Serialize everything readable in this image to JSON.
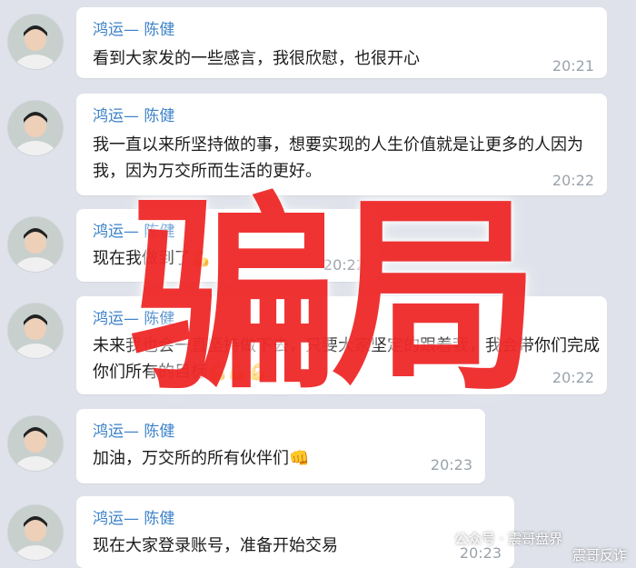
{
  "messages": [
    {
      "sender": "鸿运— 陈健",
      "text": "看到大家发的一些感言，我很欣慰，也很开心",
      "time": "20:21"
    },
    {
      "sender": "鸿运— 陈健",
      "text": "我一直以来所坚持做的事，想要实现的人生价值就是让更多的人因为我，因为万交所而生活的更好。",
      "time": "20:22"
    },
    {
      "sender": "鸿运— 陈健",
      "text": "现在我做到了💪",
      "time": "20:22"
    },
    {
      "sender": "鸿运— 陈健",
      "text": "未来我也会一直坚持做下去，只要大家坚定的跟着我，我会带你们完成你们所有的目标💪💪💪",
      "time": "20:22"
    },
    {
      "sender": "鸿运— 陈健",
      "text": "加油，万交所的所有伙伴们👊",
      "time": "20:23"
    },
    {
      "sender": "鸿运— 陈健",
      "text": "现在大家登录账号，准备开始交易",
      "time": "20:23"
    }
  ],
  "overlay_text": "骗局",
  "watermark": {
    "source": "公众号 · 震哥盘界",
    "name": "震哥反诈"
  },
  "colors": {
    "background": "#dfe2ea",
    "sender": "#3c82c9",
    "overlay": "#ef2b2b"
  }
}
